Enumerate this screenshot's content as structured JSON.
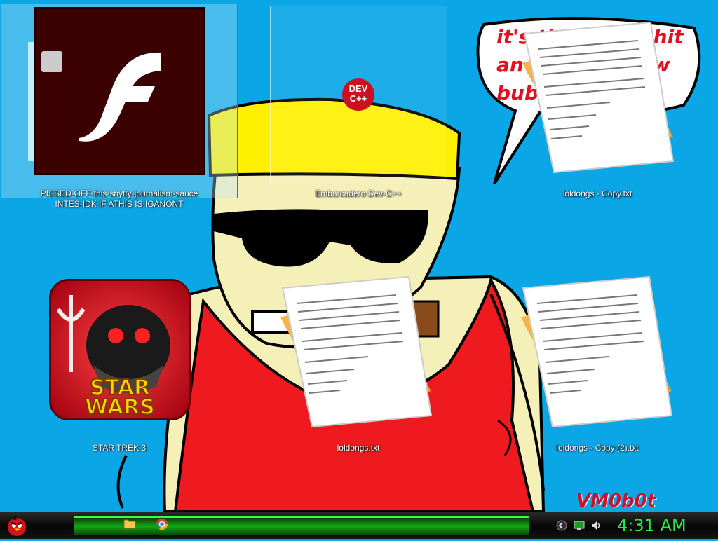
{
  "desktop": {
    "icons": [
      {
        "label": "PISSED-OFF-this-shytty-journalism-sauce INTES-IDK IF ATHIS IS IGANONT",
        "icon": "flash-icon"
      },
      {
        "label": "Embarcadero Dev-C++",
        "icon": "devcpp-icon"
      },
      {
        "label": "loldongs - Copy.txt",
        "icon": "text-document-icon"
      },
      {
        "label": "STAR TREK 3",
        "icon": "star-wars-game-icon"
      },
      {
        "label": "loldongs.txt",
        "icon": "text-document-icon"
      },
      {
        "label": "loldongs - Copy (2).txt",
        "icon": "text-document-icon"
      }
    ],
    "devcpp_badge": "DEV\nC++",
    "wallpaper_text": "it's time for the shit and the new bubble",
    "watermark": "VM0b0t"
  },
  "taskbar": {
    "start_icon": "angry-bird-start-icon",
    "pinned": [
      {
        "name": "file-explorer-icon"
      },
      {
        "name": "chrome-icon"
      }
    ],
    "tray": [
      "show-hidden-icons",
      "network-icon",
      "volume-icon"
    ],
    "clock": "4:31 AM"
  },
  "colors": {
    "desktop_bg": "#0aa6e6",
    "taskbar_accent": "#12a812",
    "clock_green": "#22ee44"
  }
}
